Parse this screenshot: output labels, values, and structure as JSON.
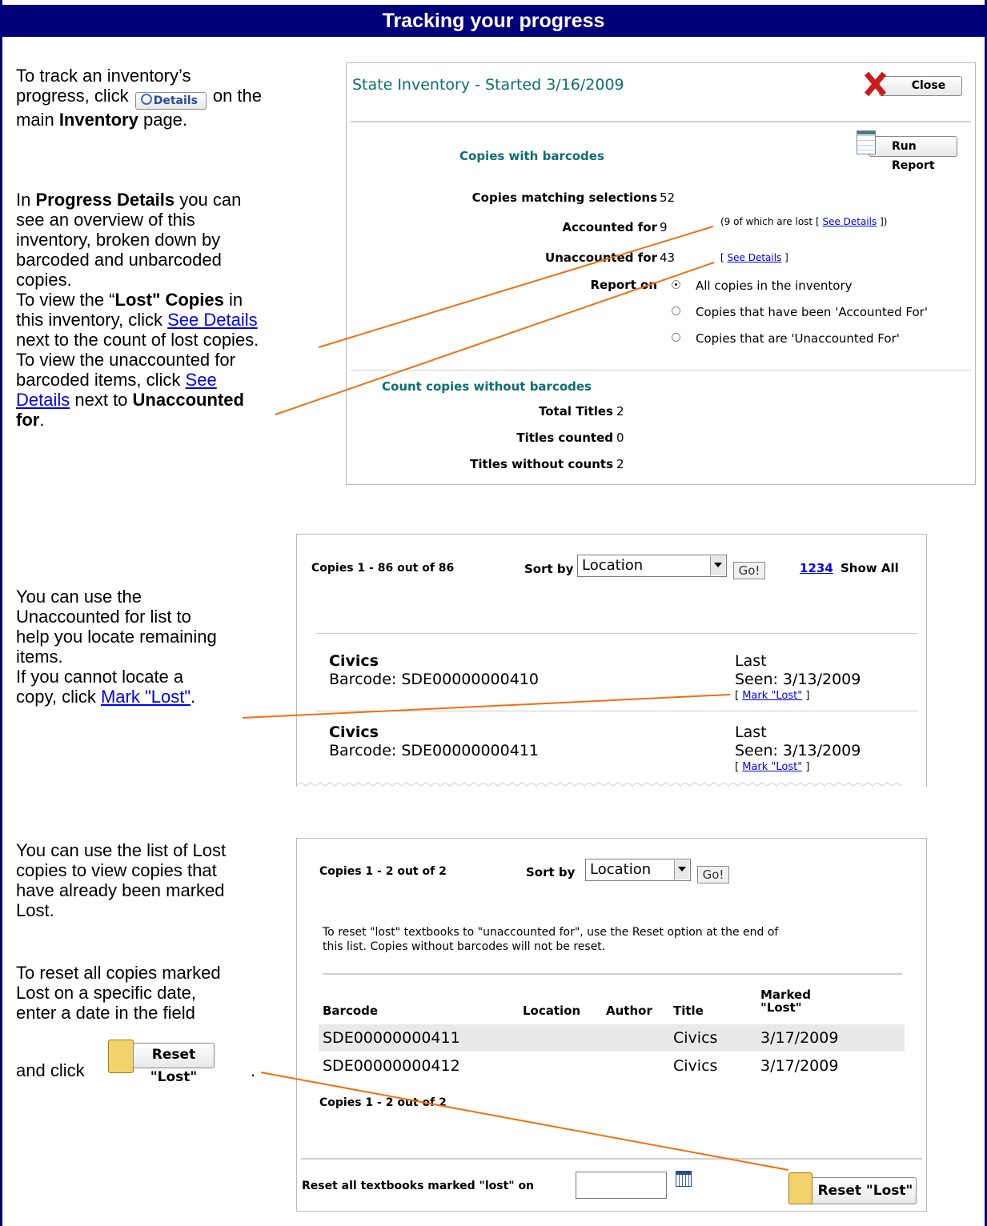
{
  "header": {
    "title": "Tracking your progress"
  },
  "left": {
    "p1": {
      "a": "To track an inventory’s",
      "b": "progress, click",
      "details_btn": "Details",
      "c": "on the",
      "d": "main",
      "e": "Inventory",
      "f": "page."
    },
    "p2": {
      "a": "In",
      "b": "Progress Details",
      "c": "you can",
      "d": "see an overview of this",
      "e": "inventory, broken down by",
      "f": "barcoded and unbarcoded",
      "g": "copies."
    },
    "p3": {
      "a": "To view the “",
      "b": "Lost\" Copies",
      "c": "in",
      "d": "this inventory, click",
      "e": "See Details",
      "f": "next to the count of lost copies."
    },
    "p4": {
      "a": "To view the unaccounted for",
      "b": "barcoded items, click",
      "c": "See",
      "d": "Details",
      "e": "next to",
      "f": "Unaccounted",
      "g": "for",
      "h": "."
    },
    "p5": {
      "a": "You can use the",
      "b": "Unaccounted for list to",
      "c": "help you locate remaining",
      "d": "items.",
      "e": "If you cannot locate a",
      "f": "copy, click",
      "g": "Mark \"Lost\"",
      "h": "."
    },
    "p6": {
      "a": "You can use the list of Lost",
      "b": "copies to view copies that",
      "c": "have already been marked",
      "d": "Lost."
    },
    "p7": {
      "a": "To reset all copies marked",
      "b": "Lost on a specific date,",
      "c": "enter a date in the field",
      "d": "and click",
      "e": "Reset \"Lost\"",
      "f": "."
    }
  },
  "panel1": {
    "title": "State Inventory - Started 3/16/2009",
    "close": "Close",
    "run_report": "Run Report",
    "barcodes_heading": "Copies with barcodes",
    "matching_label": "Copies matching selections",
    "matching_value": "52",
    "accounted_label": "Accounted for",
    "accounted_value": "9",
    "lost_note_a": "(9 of which are lost [",
    "lost_note_link": "See Details",
    "lost_note_b": "])",
    "unaccounted_label": "Unaccounted for",
    "unaccounted_value": "43",
    "unacc_a": "[",
    "unacc_link": "See Details",
    "unacc_b": "]",
    "report_on": "Report on",
    "options": [
      "All copies in the inventory",
      "Copies that have been 'Accounted For'",
      "Copies that are 'Unaccounted For'"
    ],
    "without_heading": "Count copies without barcodes",
    "total_titles_label": "Total Titles",
    "total_titles_value": "2",
    "titles_counted_label": "Titles counted",
    "titles_counted_value": "0",
    "titles_without_label": "Titles without counts",
    "titles_without_value": "2"
  },
  "panel2": {
    "count": "Copies 1 - 86 out of 86",
    "sort_by": "Sort by",
    "sort_value": "Location",
    "go": "Go!",
    "pages": [
      "1",
      "2",
      "3",
      "4"
    ],
    "show_all": "Show All",
    "rows": [
      {
        "title": "Civics",
        "barcode": "Barcode: SDE00000000410",
        "last": "Last",
        "seen": "Seen: 3/13/2009",
        "mark_a": "[",
        "mark": "Mark \"Lost\"",
        "mark_b": "]"
      },
      {
        "title": "Civics",
        "barcode": "Barcode: SDE00000000411",
        "last": "Last",
        "seen": "Seen: 3/13/2009",
        "mark_a": "[",
        "mark": "Mark \"Lost\"",
        "mark_b": "]"
      }
    ]
  },
  "panel3": {
    "count": "Copies 1 - 2 out of 2",
    "sort_by": "Sort by",
    "sort_value": "Location",
    "go": "Go!",
    "note1": "To reset \"lost\" textbooks to \"unaccounted for\", use the Reset option at the end of",
    "note2": "this list. Copies without barcodes will not be reset.",
    "columns": [
      "Barcode",
      "Location",
      "Author",
      "Title",
      "Marked",
      "\"Lost\""
    ],
    "rows": [
      {
        "barcode": "SDE00000000411",
        "title": "Civics",
        "date": "3/17/2009"
      },
      {
        "barcode": "SDE00000000412",
        "title": "Civics",
        "date": "3/17/2009"
      }
    ],
    "count_bottom": "Copies 1 - 2 out of 2",
    "reset_label": "Reset all textbooks marked \"lost\" on",
    "reset_value": "",
    "reset_btn": "Reset \"Lost\""
  },
  "colors": {
    "header": "#00007a",
    "teal": "#0c6e6e",
    "orange": "#f07010",
    "link": "#0000ee"
  }
}
